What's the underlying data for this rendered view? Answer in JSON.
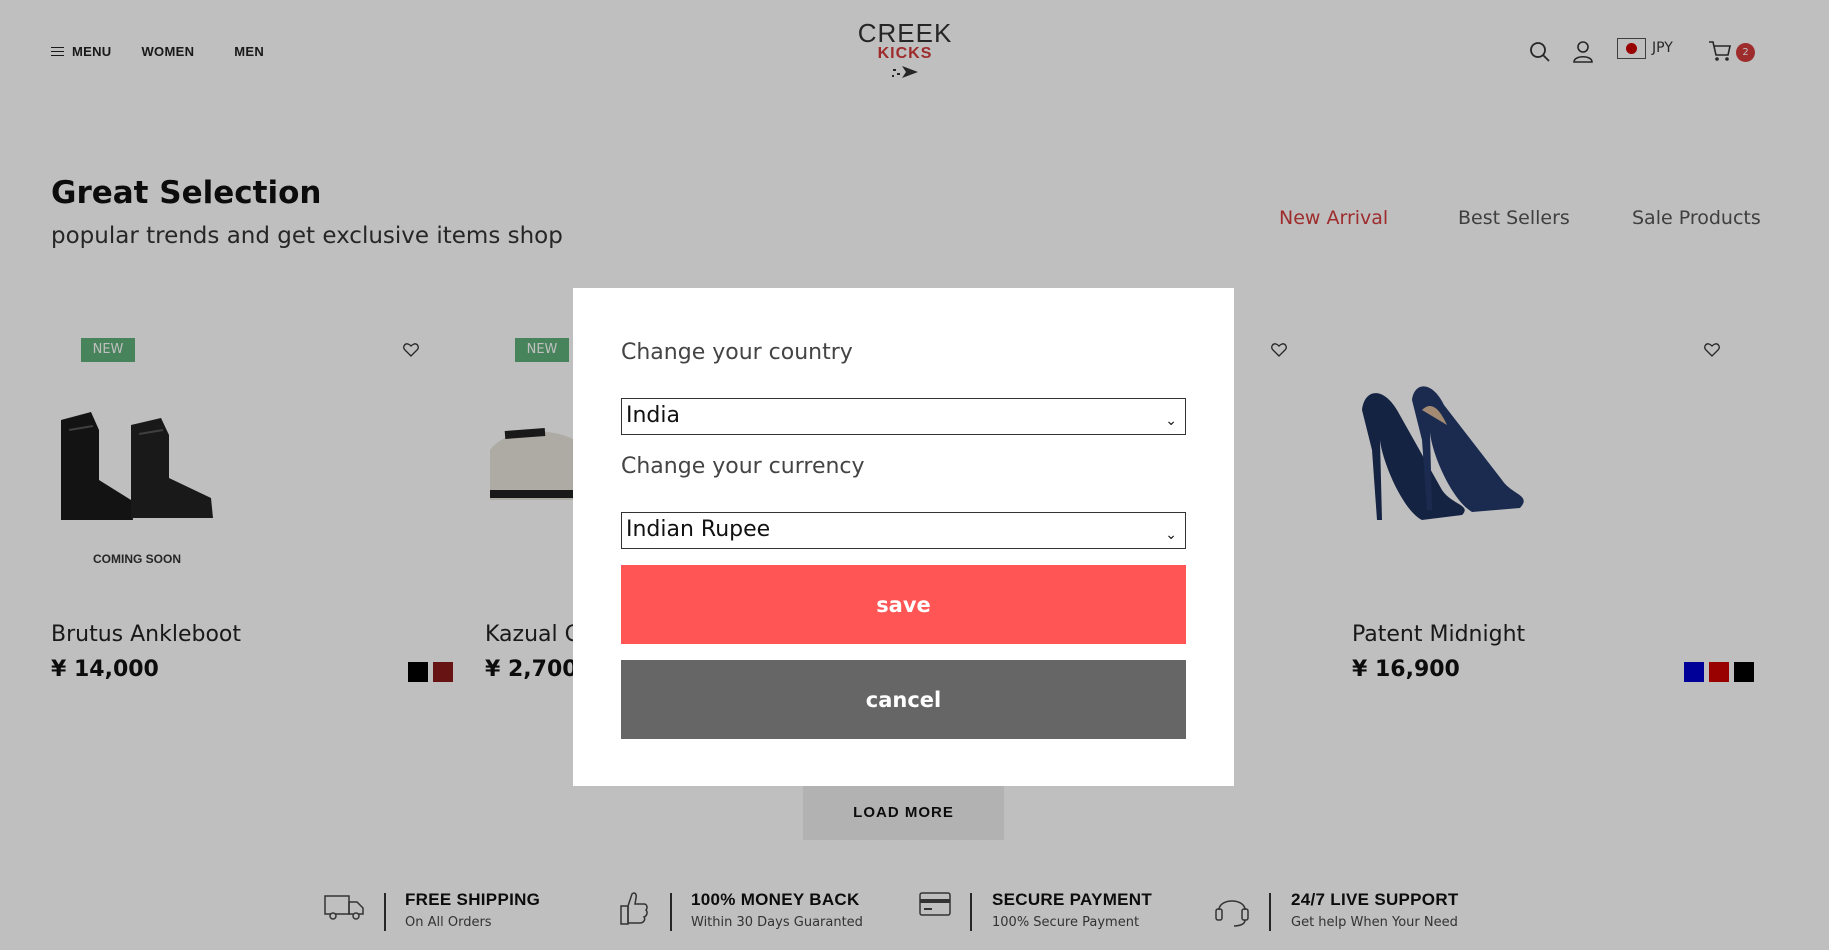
{
  "header": {
    "menu_label": "MENU",
    "women_label": "WOMEN",
    "men_label": "MEN",
    "logo_line1": "CREEK",
    "logo_line2": "KICKS",
    "currency_code": "JPY",
    "cart_count": "2",
    "icons": [
      "menu-icon",
      "search-icon",
      "user-icon",
      "japan-flag-icon",
      "cart-icon"
    ]
  },
  "section": {
    "title": "Great Selection",
    "subtitle": "popular trends and get exclusive items shop",
    "tabs": [
      {
        "label": "New Arrival",
        "active": true
      },
      {
        "label": "Best Sellers",
        "active": false
      },
      {
        "label": "Sale Products",
        "active": false
      }
    ]
  },
  "products": [
    {
      "badge": "NEW",
      "name": "Brutus Ankleboot",
      "price": "¥ 14,000",
      "note": "COMING SOON",
      "swatches": [
        "#000000",
        "#8b1a1a"
      ]
    },
    {
      "badge": "NEW",
      "name": "Kazual C",
      "price": "¥ 2,700",
      "note": "",
      "swatches": []
    },
    {
      "badge": "",
      "name": "Patent Midnight",
      "price": "¥ 16,900",
      "note": "",
      "swatches": [
        "#0000cc",
        "#cc0000",
        "#000000"
      ]
    }
  ],
  "load_more_label": "LOAD MORE",
  "features": [
    {
      "icon": "truck-icon",
      "title": "FREE SHIPPING",
      "subtitle": "On All Orders"
    },
    {
      "icon": "thumbs-up-icon",
      "title": "100% MONEY BACK",
      "subtitle": "Within 30 Days Guaranted"
    },
    {
      "icon": "credit-card-icon",
      "title": "SECURE PAYMENT",
      "subtitle": "100% Secure Payment"
    },
    {
      "icon": "headset-icon",
      "title": "24/7 LIVE SUPPORT",
      "subtitle": "Get help When Your Need"
    }
  ],
  "modal": {
    "country_label": "Change your country",
    "country_value": "India",
    "currency_label": "Change your currency",
    "currency_value": "Indian Rupee",
    "save_label": "save",
    "cancel_label": "cancel"
  },
  "colors": {
    "accent_red": "#d33b3b",
    "save_button": "#ff5555",
    "cancel_button": "#666666",
    "new_badge": "#5fb07a"
  }
}
